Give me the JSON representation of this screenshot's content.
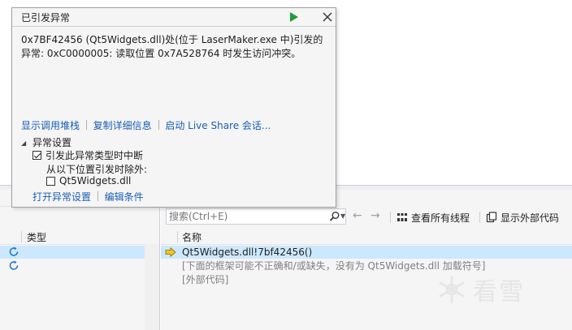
{
  "popup": {
    "title": "已引发异常",
    "message": "0x7BF42456 (Qt5Widgets.dll)处(位于 LaserMaker.exe 中)引发的异常: 0xC0000005: 读取位置 0x7A528764 时发生访问冲突。",
    "continue_icon": "play-icon",
    "close_icon": "close-icon",
    "links": [
      "显示调用堆栈",
      "复制详细信息",
      "启动 Live Share 会话..."
    ],
    "settings": {
      "header": "异常设置",
      "break_when_thrown": {
        "label": "引发此异常类型时中断",
        "checked": true
      },
      "except_label": "从以下位置引发时除外:",
      "module_exception": {
        "label": "Qt5Widgets.dll",
        "checked": false
      },
      "open_settings_link": "打开异常设置",
      "edit_conditions_link": "编辑条件"
    }
  },
  "left_panel": {
    "column_header": "类型"
  },
  "toolbar": {
    "search_placeholder": "搜索(Ctrl+E)",
    "back_glyph": "←",
    "forward_glyph": "→",
    "view_all_threads": "查看所有线程",
    "show_external_code": "显示外部代码"
  },
  "callstack": {
    "column_header": "名称",
    "frames": [
      "Qt5Widgets.dll!7bf42456()",
      "[下面的框架可能不正确和/或缺失，没有为 Qt5Widgets.dll 加载符号]",
      "[外部代码]"
    ]
  },
  "watermark": {
    "text": "看雪"
  },
  "colors": {
    "link": "#1a5fb4",
    "selection": "#cce8ff",
    "play_green": "#1e9e3a"
  }
}
